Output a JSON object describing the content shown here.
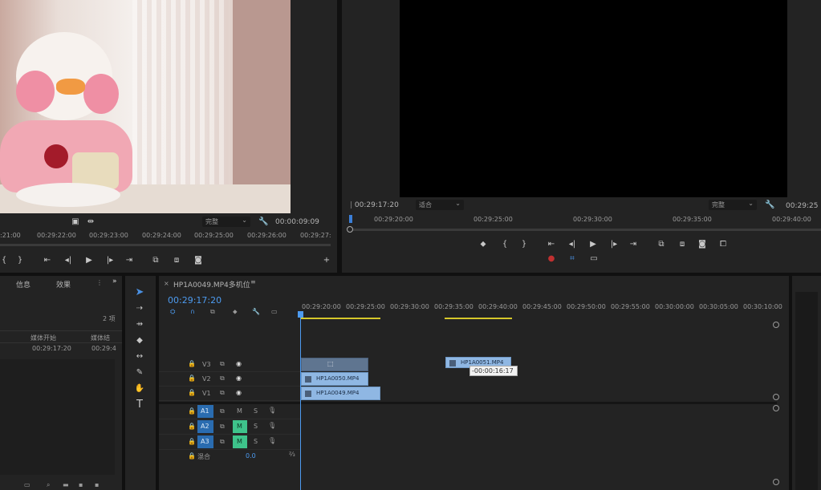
{
  "source_monitor": {
    "fit_label": "完整",
    "timecode": "00:00:09:09",
    "ruler_labels": [
      ":21:00",
      "00:29:22:00",
      "00:29:23:00",
      "00:29:24:00",
      "00:29:25:00",
      "00:29:26:00",
      "00:29:27:"
    ]
  },
  "program_monitor": {
    "timecode": "00:29:17:20",
    "fit_label": "适合",
    "quality_label": "完整",
    "right_timecode": "00:29:25",
    "ruler_labels": [
      "00:29:20:00",
      "00:29:25:00",
      "00:29:30:00",
      "00:29:35:00",
      "00:29:40:00"
    ]
  },
  "left_panel": {
    "tabs": [
      "信息",
      "效果"
    ],
    "item_count": "2 项",
    "columns": [
      "媒体开始",
      "媒体结"
    ],
    "row": [
      "00:29:17:20",
      "00:29:4"
    ]
  },
  "timeline": {
    "tab_label": "HP1A0049.MP4多机位",
    "timecode": "00:29:17:20",
    "ruler_labels": [
      "00:29:20:00",
      "00:29:25:00",
      "00:29:30:00",
      "00:29:35:00",
      "00:29:40:00",
      "00:29:45:00",
      "00:29:50:00",
      "00:29:55:00",
      "00:30:00:00",
      "00:30:05:00",
      "00:30:10:00"
    ],
    "video_tracks": [
      "V3",
      "V2",
      "V1"
    ],
    "audio_tracks": [
      "A1",
      "A2",
      "A3"
    ],
    "mix_label": "混合",
    "mix_value": "0.0",
    "clips": {
      "v2": "HP1A0050.MP4",
      "v1": "HP1A0049.MP4",
      "drag": "HP1A0051.MP4",
      "drag_offset": "-00:00:16:17"
    }
  },
  "tools": [
    "selection-tool",
    "track-select-tool",
    "ripple-edit-tool",
    "razor-tool",
    "slip-tool",
    "pen-tool",
    "hand-tool",
    "type-tool"
  ]
}
